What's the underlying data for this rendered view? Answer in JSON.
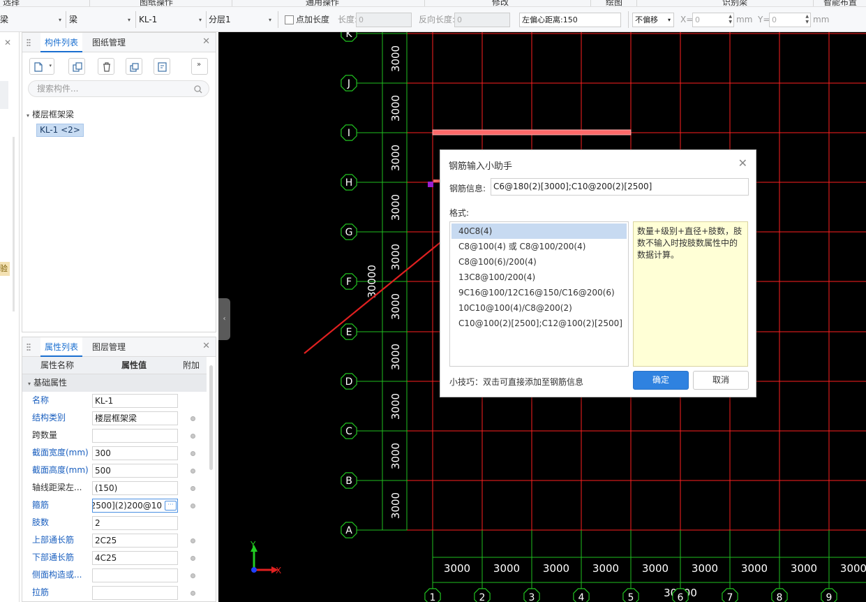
{
  "ribbon": {
    "items": [
      "选择",
      "图纸操作",
      "通用操作",
      "修改",
      "绘图",
      "识别梁",
      "智能布置"
    ]
  },
  "toolbar": {
    "sel1": "梁",
    "sel2": "梁",
    "sel3": "KL-1",
    "sel4": "分层1",
    "point_length_label": "点加长度",
    "length_label": "长度:",
    "length_value": "0",
    "reverse_length_label": "反向长度:",
    "reverse_length_value": "0",
    "offset_label": "左偏心距离:",
    "offset_value": "150",
    "no_offset": "不偏移",
    "x_label": "X=",
    "x_value": "0",
    "y_label": "Y=",
    "y_value": "0",
    "unit": "mm"
  },
  "component_panel": {
    "tab_active": "构件列表",
    "tab_other": "图纸管理",
    "search_placeholder": "搜索构件...",
    "tree_root": "楼层框架梁",
    "tree_item": "KL-1 <2>"
  },
  "property_panel": {
    "tab_active": "属性列表",
    "tab_other": "图层管理",
    "col_name": "属性名称",
    "col_value": "属性值",
    "col_extra": "附加",
    "group": "基础属性",
    "rows": [
      {
        "name": "名称",
        "value": "KL-1"
      },
      {
        "name": "结构类别",
        "value": "楼层框架梁"
      },
      {
        "name": "跨数量",
        "value": ""
      },
      {
        "name": "截面宽度(mm)",
        "value": "300"
      },
      {
        "name": "截面高度(mm)",
        "value": "500"
      },
      {
        "name": "轴线距梁左...",
        "value": "(150)"
      },
      {
        "name": "箍筋",
        "value": "10@200(2)[2500]"
      },
      {
        "name": "肢数",
        "value": "2"
      },
      {
        "name": "上部通长筋",
        "value": "2C25"
      },
      {
        "name": "下部通长筋",
        "value": "4C25"
      },
      {
        "name": "侧面构造或...",
        "value": ""
      },
      {
        "name": "拉筋",
        "value": ""
      }
    ]
  },
  "left_strip": {
    "tag": "验"
  },
  "grid": {
    "row_labels": [
      "K",
      "J",
      "I",
      "H",
      "G",
      "F",
      "E",
      "D",
      "C",
      "B",
      "A"
    ],
    "col_labels": [
      "1",
      "2",
      "3",
      "4",
      "5",
      "6",
      "7",
      "8",
      "9"
    ],
    "spacing": "3000",
    "total": "30000",
    "colors": {
      "grid": "#ff2020",
      "dim": "#20c020",
      "text": "#ffffff",
      "beam": "#ff6a6a"
    }
  },
  "axes": {
    "x": "X",
    "y": "Y"
  },
  "dialog": {
    "title": "钢筋输入小助手",
    "info_label": "钢筋信息:",
    "info_value": "C6@180(2)[3000];C10@200(2)[2500]",
    "format_label": "格式:",
    "formats": [
      "40C8(4)",
      "C8@100(4) 或 C8@100/200(4)",
      "C8@100(6)/200(4)",
      "13C8@100/200(4)",
      "9C16@100/12C16@150/C16@200(6)",
      "10C10@100(4)/C8@200(2)",
      "C10@100(2)[2500];C12@100(2)[2500]"
    ],
    "hint": "数量+级别+直径+肢数，肢数不输入时按肢数属性中的数据计算。",
    "tip": "小技巧：双击可直接添加至钢筋信息",
    "ok": "确定",
    "cancel": "取消"
  }
}
